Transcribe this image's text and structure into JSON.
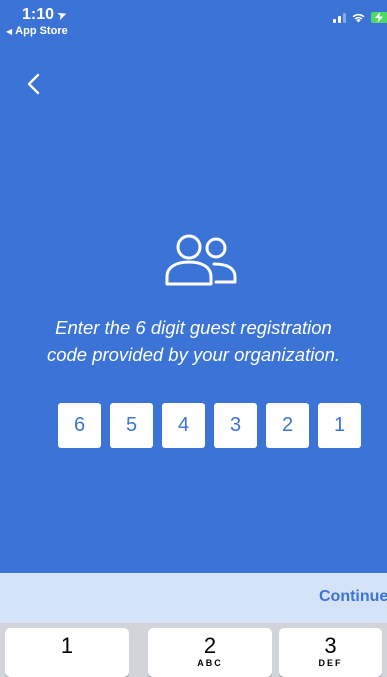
{
  "status_bar": {
    "time": "1:10",
    "location_glyph": "➤",
    "back_app_label": "App Store",
    "back_app_glyph": "◀"
  },
  "main": {
    "instructions_line1": "Enter the 6 digit guest registration",
    "instructions_line2": "code provided by your organization.",
    "code_digits": [
      "6",
      "5",
      "4",
      "3",
      "2",
      "1"
    ]
  },
  "accessory": {
    "continue_label": "Continue"
  },
  "keyboard": {
    "keys": [
      {
        "number": "1",
        "letters": ""
      },
      {
        "number": "2",
        "letters": "ABC"
      },
      {
        "number": "3",
        "letters": "DEF"
      }
    ]
  },
  "colors": {
    "primary": "#3b74d6",
    "accessory_bar": "#d4e3f7",
    "keyboard_bg": "#d1d4da",
    "battery": "#4cd964"
  },
  "icons": {
    "back": "chevron-left-icon",
    "guest": "people-icon",
    "signal": "cellular-signal-icon",
    "wifi": "wifi-icon",
    "battery": "battery-charging-icon"
  }
}
